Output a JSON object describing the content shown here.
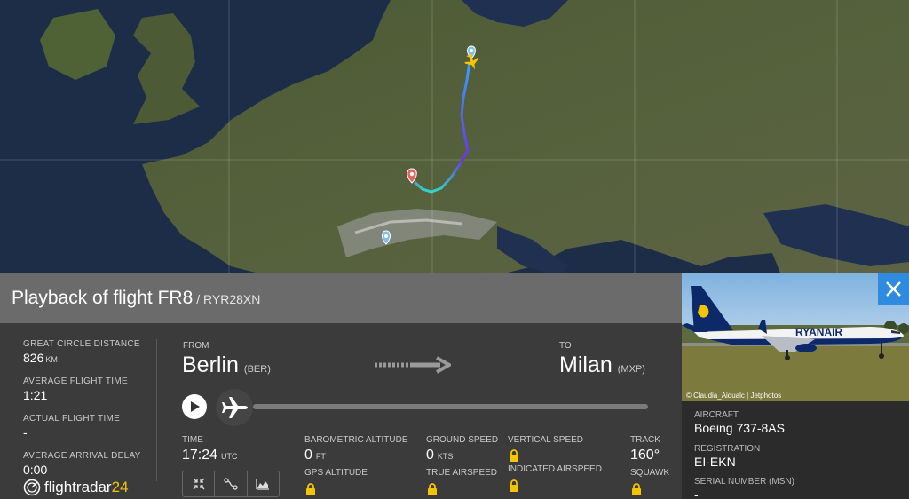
{
  "flight": {
    "title_prefix": "Playback of flight FR8",
    "callsign": "/ RYR28XN"
  },
  "stats": {
    "gc_distance_label": "GREAT CIRCLE DISTANCE",
    "gc_distance_value": "826",
    "gc_distance_unit": "KM",
    "avg_flight_time_label": "AVERAGE FLIGHT TIME",
    "avg_flight_time_value": "1:21",
    "actual_flight_time_label": "ACTUAL FLIGHT TIME",
    "actual_flight_time_value": "-",
    "avg_arrival_delay_label": "AVERAGE ARRIVAL DELAY",
    "avg_arrival_delay_value": "0:00"
  },
  "route": {
    "from_label": "FROM",
    "from_city": "Berlin",
    "from_code": "(BER)",
    "to_label": "TO",
    "to_city": "Milan",
    "to_code": "(MXP)",
    "progress": 0.0
  },
  "telemetry": {
    "time_label": "TIME",
    "time_value": "17:24",
    "time_unit": "UTC",
    "baro_alt_label": "BAROMETRIC ALTITUDE",
    "baro_alt_value": "0",
    "baro_alt_unit": "FT",
    "gps_alt_label": "GPS ALTITUDE",
    "ground_speed_label": "GROUND SPEED",
    "ground_speed_value": "0",
    "ground_speed_unit": "KTS",
    "true_airspeed_label": "TRUE AIRSPEED",
    "vertical_speed_label": "VERTICAL SPEED",
    "indicated_airspeed_label": "INDICATED AIRSPEED",
    "track_label": "TRACK",
    "track_value": "160°",
    "squawk_label": "SQUAWK"
  },
  "logo": {
    "brand": "flightradar",
    "num": "24"
  },
  "aircraft": {
    "photo_credit": "© Claudia_Aidualc | Jetphotos",
    "livery_text": "RYANAIR",
    "aircraft_label": "AIRCRAFT",
    "aircraft_value": "Boeing 737-8AS",
    "registration_label": "REGISTRATION",
    "registration_value": "EI-EKN",
    "msn_label": "SERIAL NUMBER (MSN)",
    "msn_value": "-"
  },
  "icons": {
    "close": "close-icon",
    "play": "play-icon",
    "plane": "airplane-icon",
    "tools": [
      "fit-view-icon",
      "route-icon",
      "chart-icon"
    ],
    "lock": "lock-icon"
  },
  "colors": {
    "header_bg": "#6b6b6b",
    "panel_bg": "#3b3b3b",
    "accent": "#2f8be0",
    "logo_accent": "#f5c400"
  }
}
